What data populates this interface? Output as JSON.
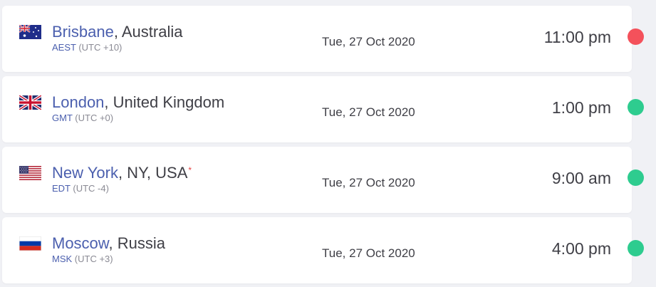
{
  "cities": [
    {
      "flag": "australia-flag",
      "city": "Brisbane",
      "country": ", Australia",
      "tz_abbr": "AEST",
      "utc": "(UTC +10)",
      "date": "Tue, 27 Oct 2020",
      "time": "11:00 pm",
      "status_color": "#f4515b",
      "dst_star": ""
    },
    {
      "flag": "united-kingdom-flag",
      "city": "London",
      "country": ", United Kingdom",
      "tz_abbr": "GMT",
      "utc": "(UTC +0)",
      "date": "Tue, 27 Oct 2020",
      "time": "1:00 pm",
      "status_color": "#2ecc8f",
      "dst_star": ""
    },
    {
      "flag": "usa-flag",
      "city": "New York",
      "country": ", NY, USA",
      "tz_abbr": "EDT",
      "utc": "(UTC -4)",
      "date": "Tue, 27 Oct 2020",
      "time": "9:00 am",
      "status_color": "#2ecc8f",
      "dst_star": "*"
    },
    {
      "flag": "russia-flag",
      "city": "Moscow",
      "country": ", Russia",
      "tz_abbr": "MSK",
      "utc": "(UTC +3)",
      "date": "Tue, 27 Oct 2020",
      "time": "4:00 pm",
      "status_color": "#2ecc8f",
      "dst_star": ""
    }
  ]
}
